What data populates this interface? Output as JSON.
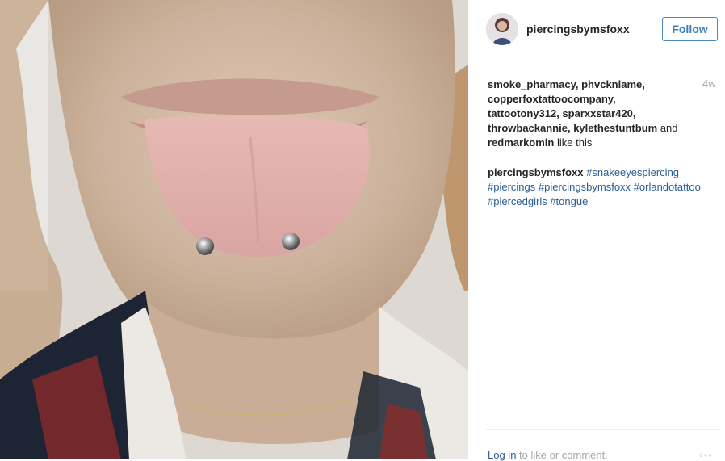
{
  "post": {
    "author": "piercingsbymsfoxx",
    "follow_label": "Follow",
    "timestamp": "4w",
    "likes": {
      "names": "smoke_pharmacy, phvcknlame, copperfoxtattoocompany, tattootony312, sparxxstar420, throwbackannie, kylethestuntbum",
      "connector": "and",
      "last_name": "redmarkomin",
      "suffix": "like this"
    },
    "caption": {
      "username": "piercingsbymsfoxx",
      "hashtags": [
        "#snakeeyespiercing",
        "#piercings",
        "#piercingsbymsfoxx",
        "#orlandotattoo",
        "#piercedgirls",
        "#tongue"
      ]
    },
    "footer": {
      "login_link": "Log in",
      "login_suffix": "to like or comment."
    },
    "more_icon": "ellipsis-icon"
  },
  "colors": {
    "link": "#2c5c93",
    "follow_border": "#4a89c0",
    "muted": "#a5a7aa"
  }
}
